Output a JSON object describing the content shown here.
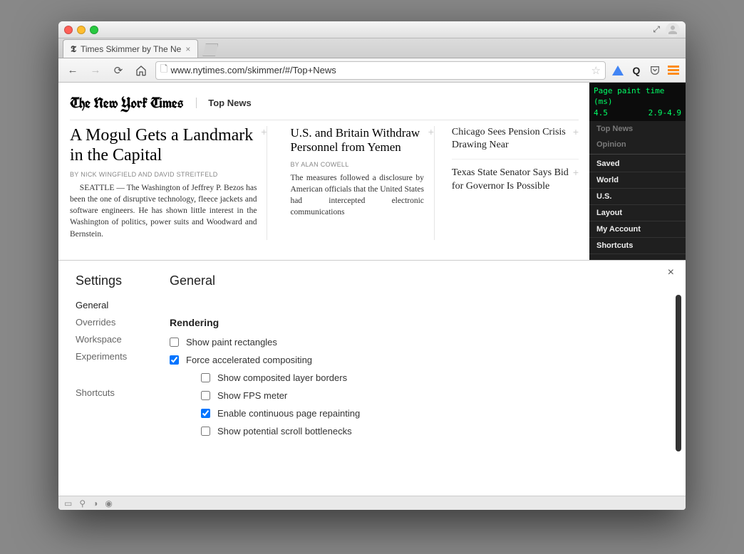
{
  "window": {
    "tab_title": "Times Skimmer by The Ne",
    "url": "www.nytimes.com/skimmer/#/Top+News"
  },
  "nyt": {
    "logo": "The New York Times",
    "section": "Top News",
    "col1": {
      "headline": "A Mogul Gets a Landmark in the Capital",
      "byline": "BY NICK WINGFIELD AND DAVID STREITFELD",
      "body": "SEATTLE — The Washington of Jeffrey P. Bezos has been the one of disruptive technology, fleece jackets and software engineers. He has shown little interest in the Washington of politics, power suits and Woodward and Bernstein."
    },
    "col2": {
      "headline": "U.S. and Britain Withdraw Personnel from Yemen",
      "byline": "BY ALAN COWELL",
      "body": "The measures followed a disclosure by American officials that the United States had intercepted electronic communications"
    },
    "col3": {
      "mini1": "Chicago Sees Pension Crisis Drawing Near",
      "mini2": "Texas State Senator Says Bid for Governor Is Possible"
    },
    "overlay": {
      "label": "Page paint time (ms)",
      "current": "4.5",
      "range": "2.9-4.9"
    },
    "side": {
      "ghost1": "Top News",
      "ghost2": "Opinion",
      "items": [
        "Saved",
        "World",
        "U.S.",
        "Layout",
        "My Account",
        "Shortcuts"
      ]
    }
  },
  "devtools": {
    "title": "Settings",
    "nav": [
      "General",
      "Overrides",
      "Workspace",
      "Experiments"
    ],
    "nav_shortcuts": "Shortcuts",
    "heading": "General",
    "section": "Rendering",
    "opts": [
      {
        "label": "Show paint rectangles",
        "checked": false,
        "sub": false
      },
      {
        "label": "Force accelerated compositing",
        "checked": true,
        "sub": false
      },
      {
        "label": "Show composited layer borders",
        "checked": false,
        "sub": true
      },
      {
        "label": "Show FPS meter",
        "checked": false,
        "sub": true
      },
      {
        "label": "Enable continuous page repainting",
        "checked": true,
        "sub": true
      },
      {
        "label": "Show potential scroll bottlenecks",
        "checked": false,
        "sub": true
      }
    ]
  }
}
